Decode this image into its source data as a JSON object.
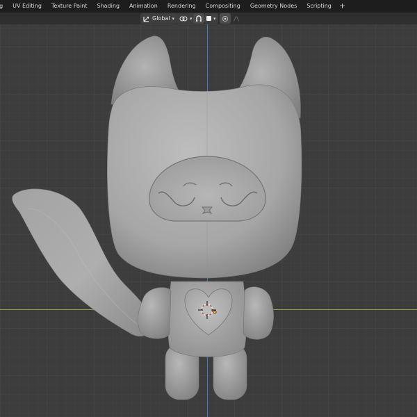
{
  "workspace_tabs": [
    {
      "label": "ng",
      "active": false
    },
    {
      "label": "UV Editing",
      "active": false
    },
    {
      "label": "Texture Paint",
      "active": false
    },
    {
      "label": "Shading",
      "active": false
    },
    {
      "label": "Animation",
      "active": false
    },
    {
      "label": "Rendering",
      "active": false
    },
    {
      "label": "Compositing",
      "active": false
    },
    {
      "label": "Geometry Nodes",
      "active": false
    },
    {
      "label": "Scripting",
      "active": false
    }
  ],
  "add_tab_label": "+",
  "header": {
    "orientation_label": "Global",
    "orientation_icon": "transform-orientation-icon",
    "pivot_icon": "pivot-point-icon",
    "snap_icon": "snap-magnet-icon",
    "proportional_icon": "proportional-editing-icon"
  },
  "colors": {
    "grid_bg": "#3d3d3d",
    "x_axis": "#9a3a43",
    "y_axis_vertical": "#3f78ba",
    "green_axis": "#8aa23a",
    "model": "#a9a9a9"
  }
}
